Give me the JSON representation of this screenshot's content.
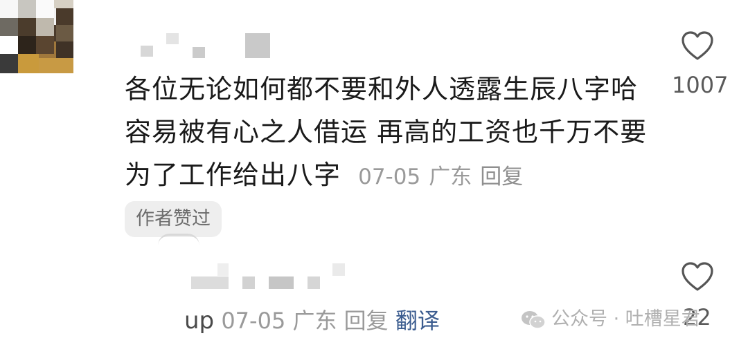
{
  "comment": {
    "text": "各位无论如何都不要和外人透露生辰八字哈容易被有心之人借运 再高的工资也千万不要为了工作给出八字",
    "date": "07-05",
    "location": "广东",
    "reply_label": "回复",
    "likes": "1007",
    "author_badge": "作者赞过"
  },
  "reply": {
    "username": "up",
    "date": "07-05",
    "location": "广东",
    "reply_label": "回复",
    "translate_label": "翻译",
    "likes": "22"
  },
  "watermark": {
    "text": "公众号 · 吐槽星君",
    "icon": "wechat-icon"
  },
  "colors": {
    "text": "#1a1a1a",
    "meta": "#9a9a9a",
    "badge_bg": "#eeeeee",
    "translate": "#3b5c8f"
  }
}
